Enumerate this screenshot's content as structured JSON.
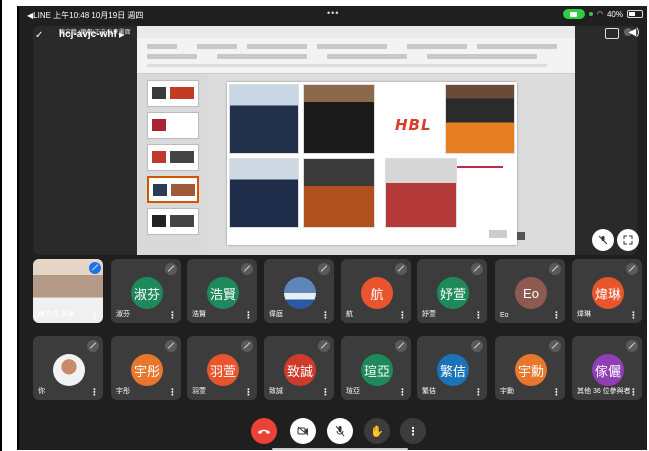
{
  "status_bar": {
    "left_text": "◀LINE  上午10:48  10月19日 週四",
    "battery_text": "40%"
  },
  "meeting": {
    "code": "hcj-avjc-whf",
    "presenter_overlay": "陳文偉 (簡報)正在分享畫面"
  },
  "slide": {
    "logo_text": "HBL"
  },
  "tiles": [
    {
      "name": "陳文偉 清華",
      "avatar": "",
      "color": "#000000",
      "photo": true
    },
    {
      "name": "淑芬",
      "avatar": "淑芬",
      "color": "#1e8a5c"
    },
    {
      "name": "浩賢",
      "avatar": "浩賢",
      "color": "#1e8a5c"
    },
    {
      "name": "偉庭",
      "avatar": "",
      "color": "#2c3e50",
      "photo": true
    },
    {
      "name": "航",
      "avatar": "航",
      "color": "#e8552d"
    },
    {
      "name": "妤萱",
      "avatar": "妤萱",
      "color": "#1e8a5c"
    },
    {
      "name": "Eo",
      "avatar": "Eo",
      "color": "#8d5a52"
    },
    {
      "name": "煒琳",
      "avatar": "煒琳",
      "color": "#e8552d"
    },
    {
      "name": "你",
      "avatar": "",
      "color": "#ffffff",
      "photo": true
    },
    {
      "name": "宇彤",
      "avatar": "宇彤",
      "color": "#e8772d"
    },
    {
      "name": "羽萱",
      "avatar": "羽萱",
      "color": "#e8552d"
    },
    {
      "name": "致誠",
      "avatar": "致誠",
      "color": "#d03a2a"
    },
    {
      "name": "瑄亞",
      "avatar": "瑄亞",
      "color": "#1e8a5c"
    },
    {
      "name": "繁佶",
      "avatar": "繁佶",
      "color": "#1a73b8"
    },
    {
      "name": "宇勳",
      "avatar": "宇勳",
      "color": "#e8772d"
    },
    {
      "name": "其他 36 位參與者",
      "avatar": "傢儷",
      "color": "#8e3fb5"
    }
  ],
  "controls": {
    "end_call": "end-call",
    "camera": "camera-off",
    "mic": "mic-off",
    "hand": "raise-hand",
    "more": "more"
  },
  "colors": {
    "end_call": "#ea4335",
    "background": "#1f1f1f",
    "tile": "#3c3c3c"
  }
}
